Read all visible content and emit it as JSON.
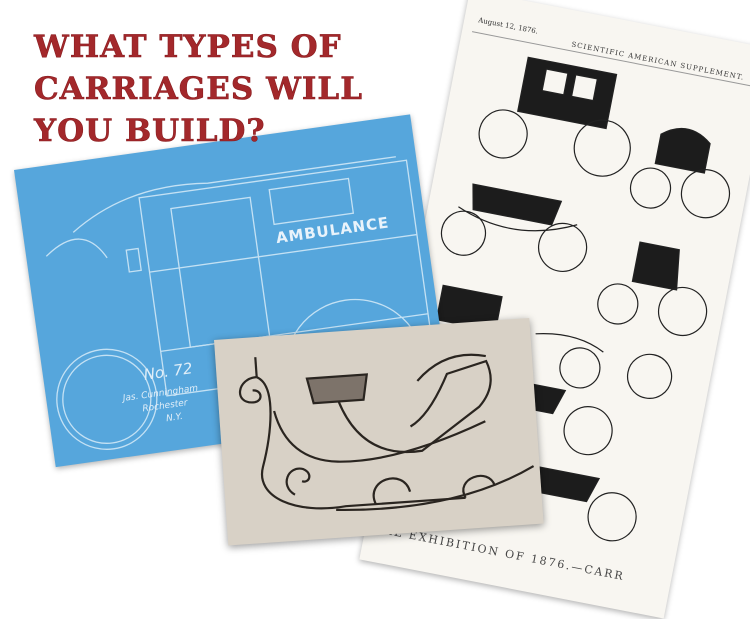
{
  "title": {
    "lines": [
      "What types of",
      "carriages will",
      "you build?"
    ],
    "color": "#a3282b"
  },
  "magazine": {
    "date": "August 12, 1876.",
    "header": "SCIENTIFIC AMERICAN SUPPLEMENT.",
    "footer": "NATIONAL EXHIBITION OF 1876.—CARR"
  },
  "blueprint": {
    "label": "AMBULANCE",
    "number": "No. 72",
    "maker": [
      "Jas. Cunningham",
      "Rochester",
      "N.Y."
    ],
    "color": "#56a6dc"
  },
  "photo": {
    "subject": "sleigh-drawing"
  }
}
